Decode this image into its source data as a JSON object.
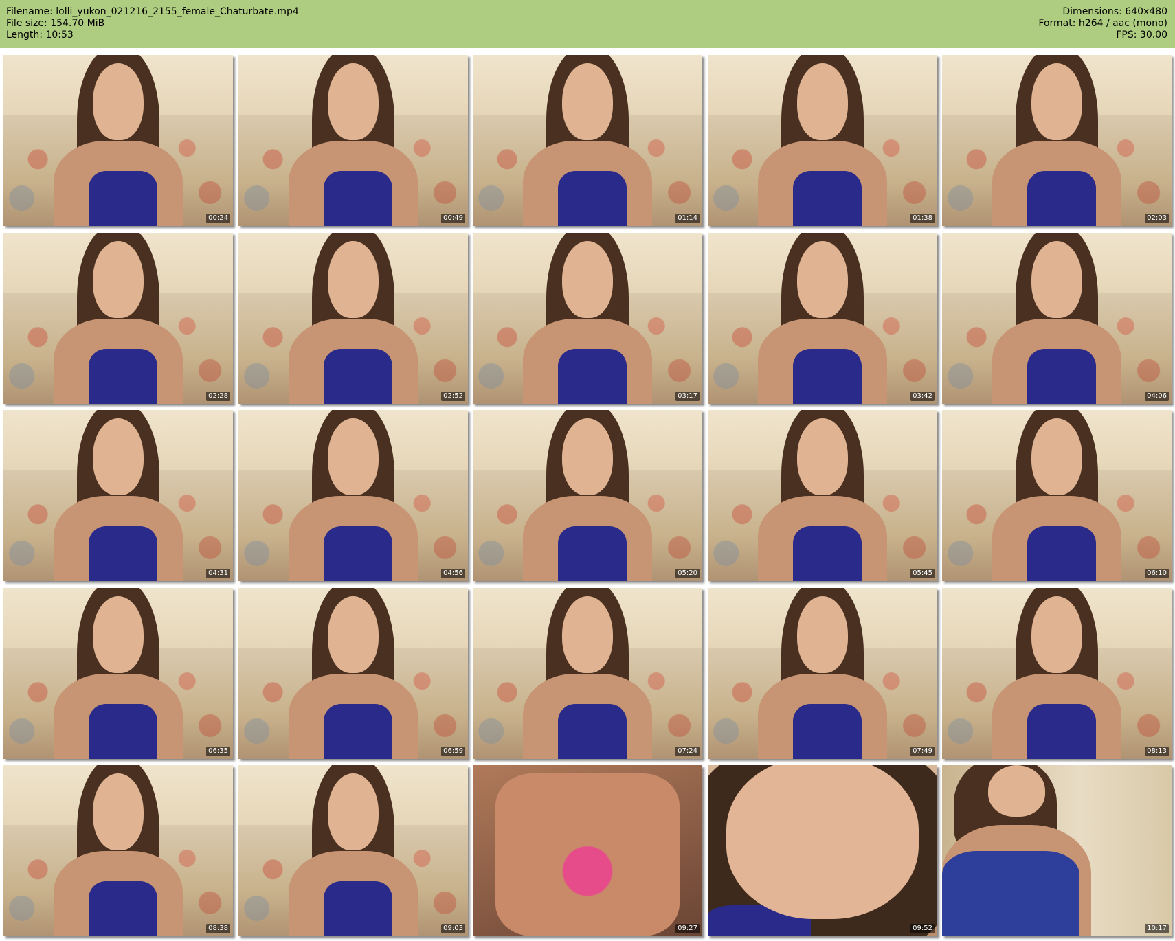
{
  "header": {
    "filename": "Filename: lolli_yukon_021216_2155_female_Chaturbate.mp4",
    "filesize": "File size: 154.70 MiB",
    "length": "Length: 10:53",
    "dimensions": "Dimensions: 640x480",
    "format": "Format: h264 / aac (mono)",
    "fps": "FPS: 30.00",
    "background_color": "#afcd80"
  },
  "thumbnails": [
    {
      "time": "00:24",
      "scene": "webcam"
    },
    {
      "time": "00:49",
      "scene": "webcam"
    },
    {
      "time": "01:14",
      "scene": "webcam"
    },
    {
      "time": "01:38",
      "scene": "webcam"
    },
    {
      "time": "02:03",
      "scene": "webcam"
    },
    {
      "time": "02:28",
      "scene": "webcam"
    },
    {
      "time": "02:52",
      "scene": "webcam"
    },
    {
      "time": "03:17",
      "scene": "webcam"
    },
    {
      "time": "03:42",
      "scene": "webcam"
    },
    {
      "time": "04:06",
      "scene": "webcam"
    },
    {
      "time": "04:31",
      "scene": "webcam"
    },
    {
      "time": "04:56",
      "scene": "webcam"
    },
    {
      "time": "05:20",
      "scene": "webcam"
    },
    {
      "time": "05:45",
      "scene": "webcam"
    },
    {
      "time": "06:10",
      "scene": "webcam"
    },
    {
      "time": "06:35",
      "scene": "webcam"
    },
    {
      "time": "06:59",
      "scene": "webcam"
    },
    {
      "time": "07:24",
      "scene": "webcam"
    },
    {
      "time": "07:49",
      "scene": "webcam"
    },
    {
      "time": "08:13",
      "scene": "webcam"
    },
    {
      "time": "08:38",
      "scene": "webcam"
    },
    {
      "time": "09:03",
      "scene": "webcam"
    },
    {
      "time": "09:27",
      "scene": "closeup"
    },
    {
      "time": "09:52",
      "scene": "closeup2"
    },
    {
      "time": "10:17",
      "scene": "room"
    }
  ]
}
